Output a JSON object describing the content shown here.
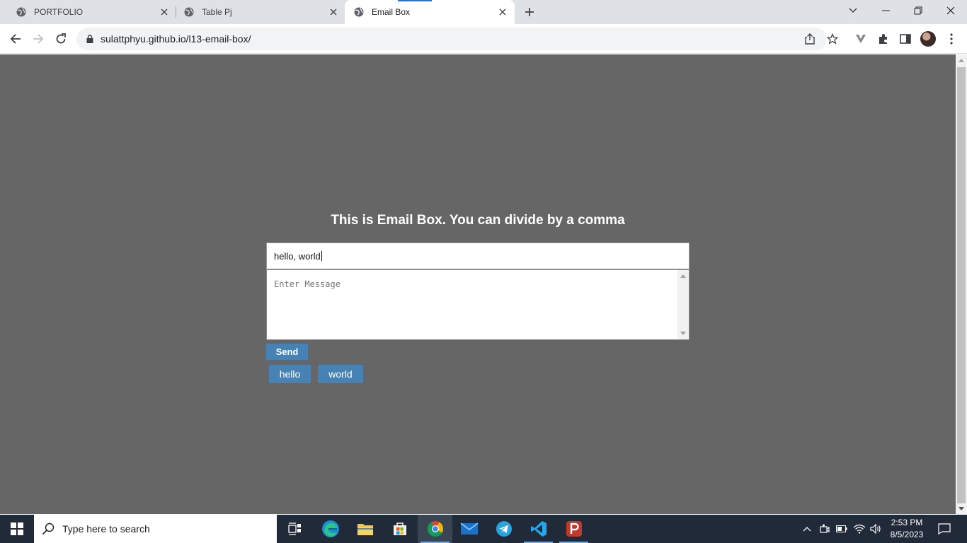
{
  "browser": {
    "tabs": [
      {
        "title": "PORTFOLIO",
        "active": false
      },
      {
        "title": "Table Pj",
        "active": false
      },
      {
        "title": "Email Box",
        "active": true
      }
    ],
    "url": "sulattphyu.github.io/l13-email-box/"
  },
  "page": {
    "background": "#666666",
    "heading": "This is Email Box. You can divide by a comma",
    "email_input_value": "hello, world",
    "message_placeholder": "Enter Message",
    "send_label": "Send",
    "tags": [
      "hello",
      "world"
    ],
    "accent_color": "#4682b4"
  },
  "taskbar": {
    "search_placeholder": "Type here to search",
    "apps": [
      "task-view",
      "edge",
      "file-explorer",
      "microsoft-store",
      "chrome",
      "mail",
      "telegram",
      "vscode",
      "p-app"
    ],
    "time": "2:53 PM",
    "date": "8/5/2023"
  }
}
